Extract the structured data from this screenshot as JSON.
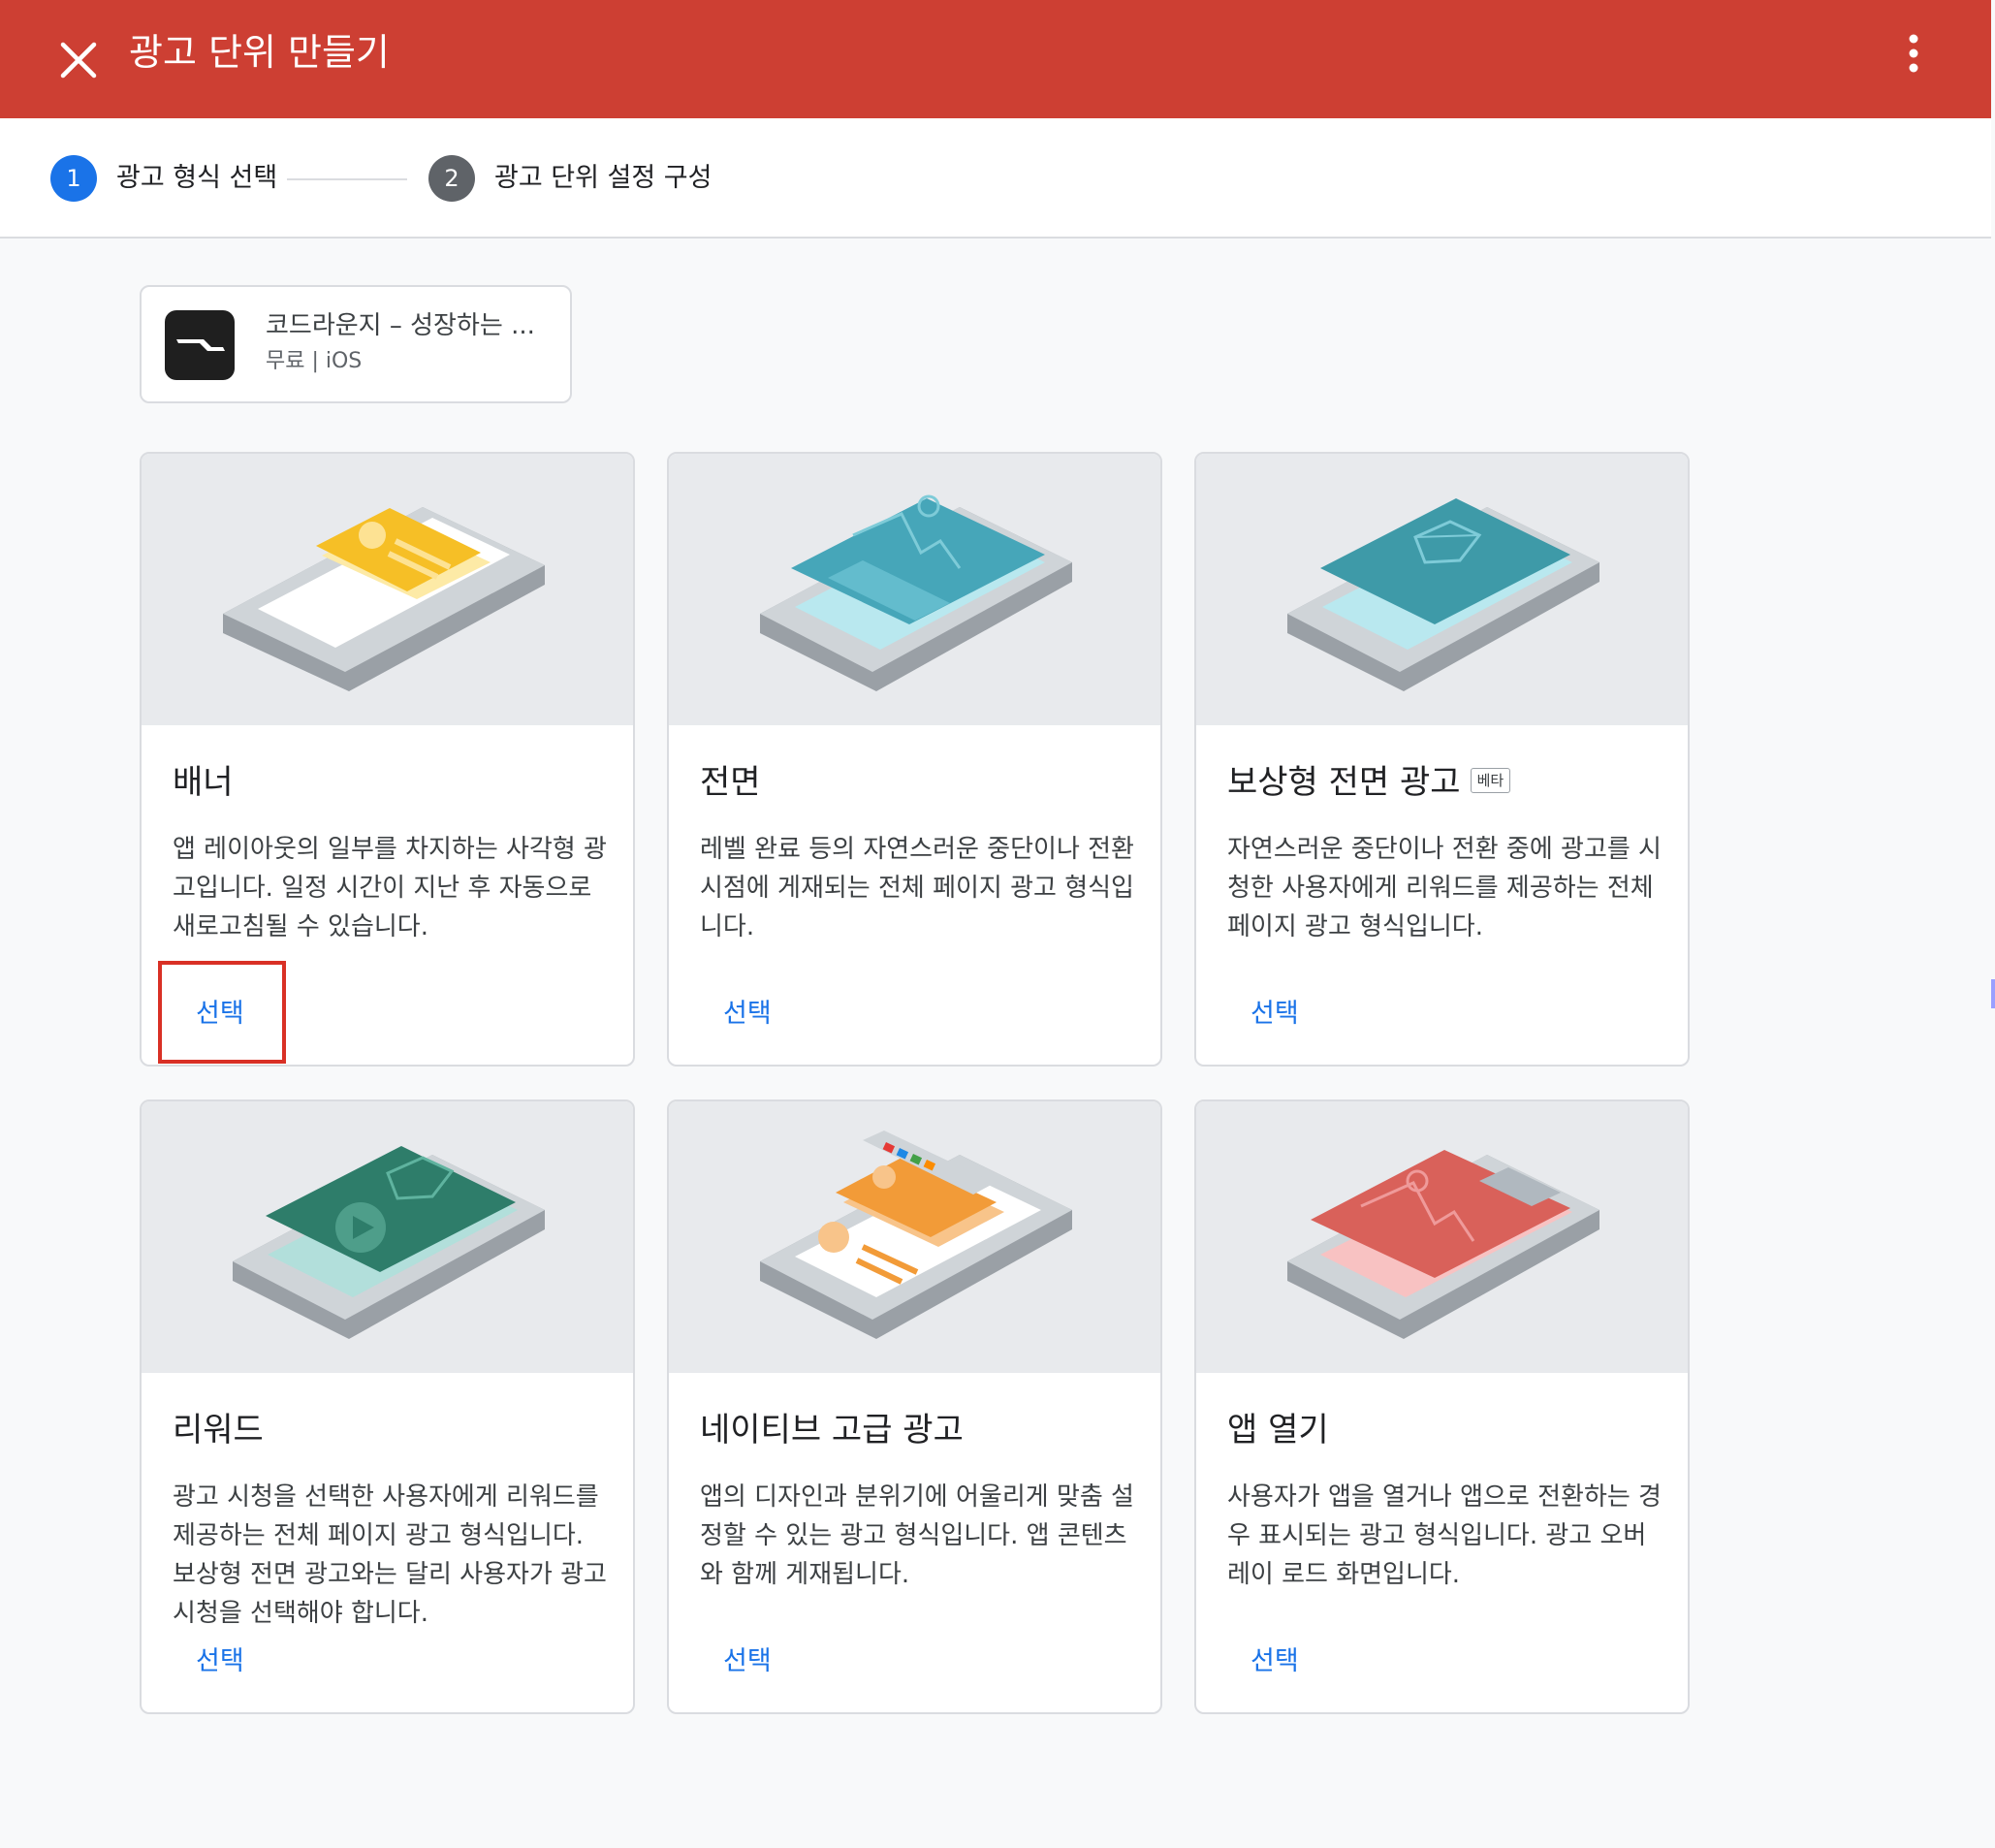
{
  "header": {
    "title": "광고 단위 만들기",
    "close_icon": "close-icon",
    "more_icon": "more-vert-icon",
    "background_color": "#cd3f33"
  },
  "stepper": {
    "steps": [
      {
        "number": "1",
        "label": "광고 형식 선택",
        "active": true,
        "color": "#1a73e8"
      },
      {
        "number": "2",
        "label": "광고 단위 설정 구성",
        "active": false,
        "color": "#5f6368"
      }
    ]
  },
  "app": {
    "name": "코드라운지 – 성장하는 ...",
    "meta": "무료 | iOS"
  },
  "formats": [
    {
      "title": "배너",
      "description": "앱 레이아웃의 일부를 차지하는 사각형 광고입니다. 일정 시간이 지난 후 자동으로 새로고침될 수 있습니다.",
      "select_label": "선택",
      "accent": "#f6bf26"
    },
    {
      "title": "전면",
      "description": "레벨 완료 등의 자연스러운 중단이나 전환 시점에 게재되는 전체 페이지 광고 형식입니다.",
      "select_label": "선택",
      "accent": "#46a6b9"
    },
    {
      "title": "보상형 전면 광고",
      "badge": "베타",
      "description": "자연스러운 중단이나 전환 중에 광고를 시청한 사용자에게 리워드를 제공하는 전체 페이지 광고 형식입니다.",
      "select_label": "선택",
      "accent": "#3e9aa8"
    },
    {
      "title": "리워드",
      "description": "광고 시청을 선택한 사용자에게 리워드를 제공하는 전체 페이지 광고 형식입니다. 보상형 전면 광고와는 달리 사용자가 광고 시청을 선택해야 합니다.",
      "select_label": "선택",
      "accent": "#2e7d6a"
    },
    {
      "title": "네이티브 고급 광고",
      "description": "앱의 디자인과 분위기에 어울리게 맞춤 설정할 수 있는 광고 형식입니다. 앱 콘텐츠와 함께 게재됩니다.",
      "select_label": "선택",
      "accent": "#f29b38"
    },
    {
      "title": "앱 열기",
      "description": "사용자가 앱을 열거나 앱으로 전환하는 경우 표시되는 광고 형식입니다. 광고 오버레이 로드 화면입니다.",
      "select_label": "선택",
      "accent": "#d9615a"
    }
  ]
}
